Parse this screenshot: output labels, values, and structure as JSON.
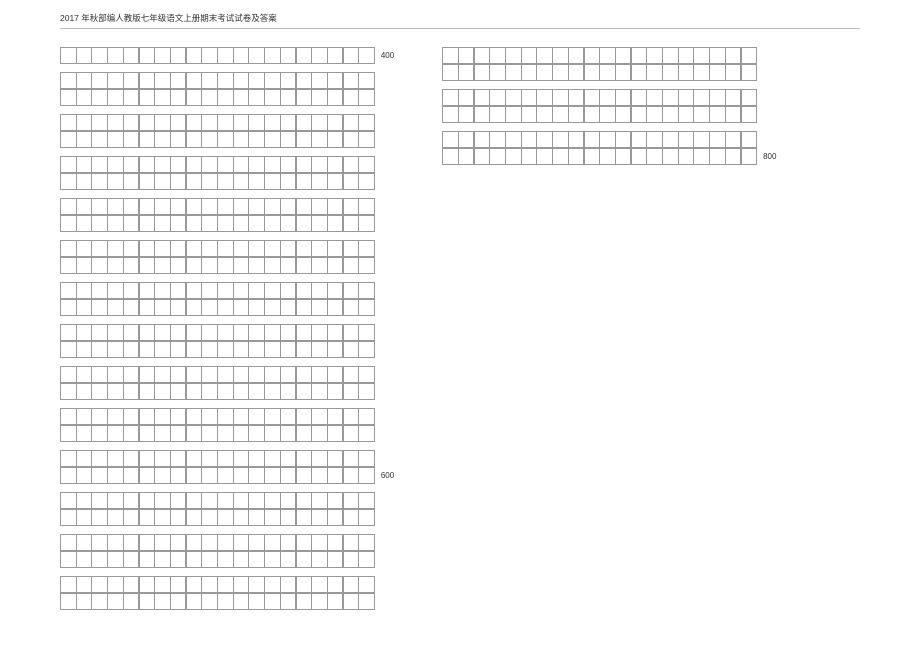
{
  "header": {
    "title": "2017 年秋部编人教版七年级语文上册期末考试试卷及答案"
  },
  "grid": {
    "cols_per_row": 20,
    "left_col": {
      "blocks": [
        {
          "rows": 1,
          "label_last": "400"
        },
        {
          "rows": 2,
          "label_last": null
        },
        {
          "rows": 2,
          "label_last": null
        },
        {
          "rows": 2,
          "label_last": null
        },
        {
          "rows": 2,
          "label_last": null
        },
        {
          "rows": 2,
          "label_last": null
        },
        {
          "rows": 2,
          "label_last": null
        },
        {
          "rows": 2,
          "label_last": null
        },
        {
          "rows": 2,
          "label_last": null
        },
        {
          "rows": 2,
          "label_last": null
        },
        {
          "rows": 2,
          "label_last": "600"
        },
        {
          "rows": 2,
          "label_last": null
        },
        {
          "rows": 2,
          "label_last": null
        },
        {
          "rows": 2,
          "label_last": null
        }
      ]
    },
    "right_col": {
      "blocks": [
        {
          "rows": 2,
          "label_last": null
        },
        {
          "rows": 2,
          "label_last": null
        },
        {
          "rows": 2,
          "label_last": "800"
        }
      ]
    }
  }
}
